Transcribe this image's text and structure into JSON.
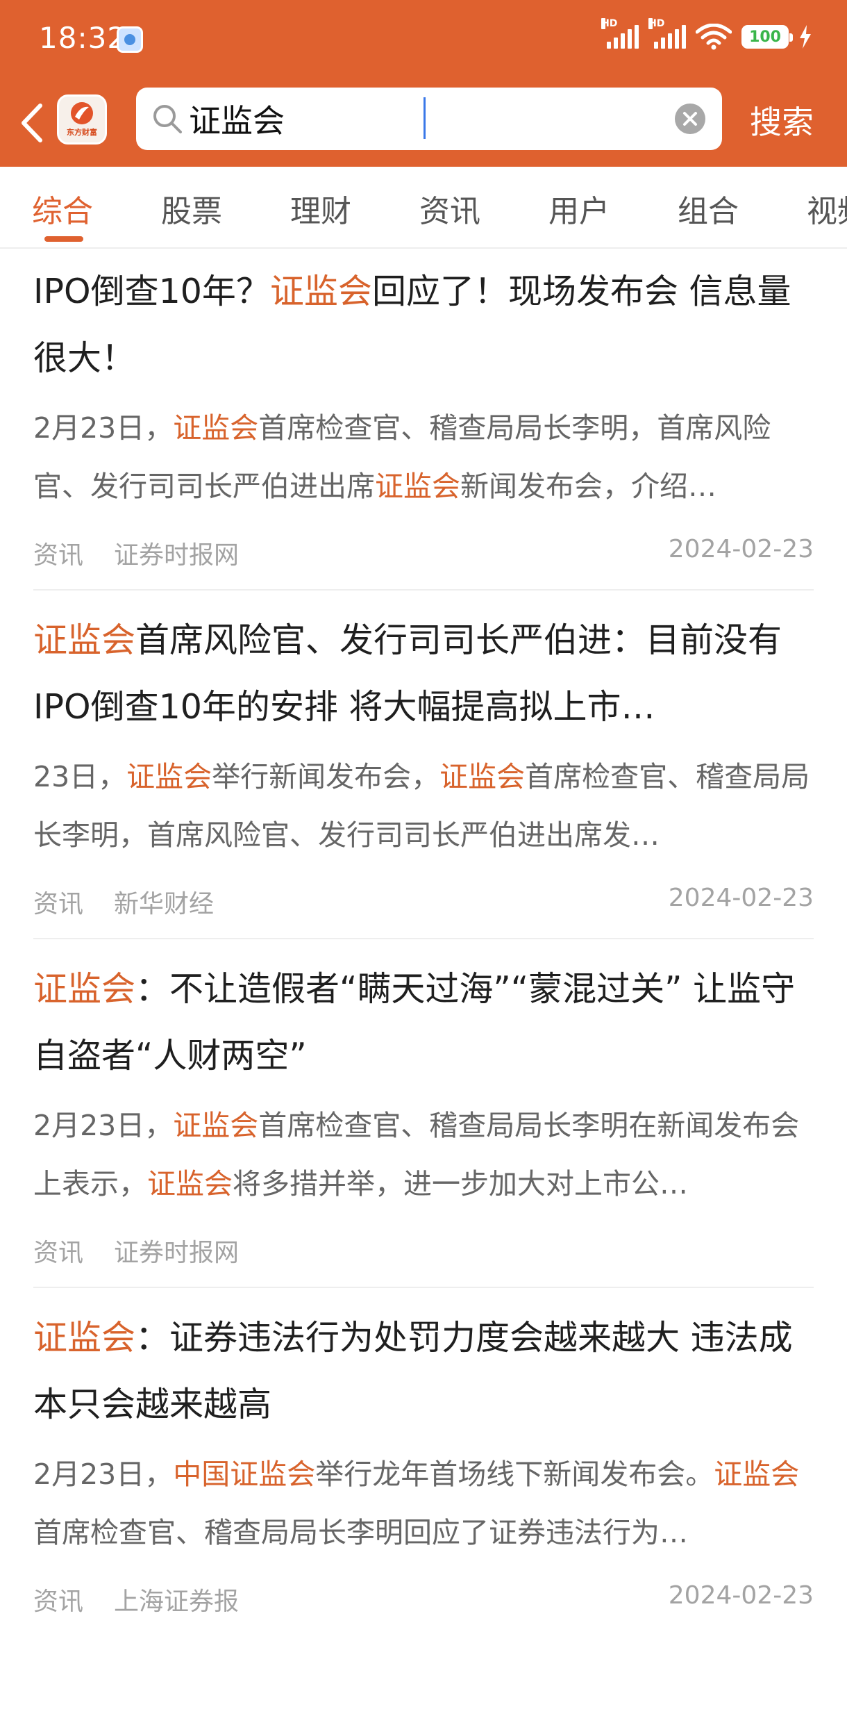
{
  "status_bar": {
    "time": "18:32",
    "battery": "100",
    "hd1": "HD",
    "hd2": "HD"
  },
  "search": {
    "query": "证监会",
    "button_label": "搜索"
  },
  "tabs": [
    "综合",
    "股票",
    "理财",
    "资讯",
    "用户",
    "组合",
    "视频"
  ],
  "accent_color": "#df612f",
  "results": [
    {
      "title_parts": [
        {
          "t": "IPO倒查10年？",
          "h": false
        },
        {
          "t": "证监会",
          "h": true
        },
        {
          "t": "回应了！现场发布会 信息量很大！",
          "h": false
        }
      ],
      "summary_parts": [
        {
          "t": "2月23日，",
          "h": false
        },
        {
          "t": "证监会",
          "h": true
        },
        {
          "t": "首席检查官、稽查局局长李明，首席风险官、发行司司长严伯进出席",
          "h": false
        },
        {
          "t": "证监会",
          "h": true
        },
        {
          "t": "新闻发布会，介绍…",
          "h": false
        }
      ],
      "type": "资讯",
      "source": "证券时报网",
      "date": "2024-02-23"
    },
    {
      "title_parts": [
        {
          "t": "证监会",
          "h": true
        },
        {
          "t": "首席风险官、发行司司长严伯进：目前没有IPO倒查10年的安排 将大幅提高拟上市…",
          "h": false
        }
      ],
      "summary_parts": [
        {
          "t": "23日，",
          "h": false
        },
        {
          "t": "证监会",
          "h": true
        },
        {
          "t": "举行新闻发布会，",
          "h": false
        },
        {
          "t": "证监会",
          "h": true
        },
        {
          "t": "首席检查官、稽查局局长李明，首席风险官、发行司司长严伯进出席发…",
          "h": false
        }
      ],
      "type": "资讯",
      "source": "新华财经",
      "date": "2024-02-23"
    },
    {
      "title_parts": [
        {
          "t": "证监会",
          "h": true
        },
        {
          "t": "：不让造假者“瞒天过海”“蒙混过关” 让监守自盗者“人财两空”",
          "h": false
        }
      ],
      "summary_parts": [
        {
          "t": "2月23日，",
          "h": false
        },
        {
          "t": "证监会",
          "h": true
        },
        {
          "t": "首席检查官、稽查局局长李明在新闻发布会上表示，",
          "h": false
        },
        {
          "t": "证监会",
          "h": true
        },
        {
          "t": "将多措并举，进一步加大对上市公…",
          "h": false
        }
      ],
      "type": "资讯",
      "source": "证券时报网",
      "date": ""
    },
    {
      "title_parts": [
        {
          "t": "证监会",
          "h": true
        },
        {
          "t": "：证券违法行为处罚力度会越来越大 违法成本只会越来越高",
          "h": false
        }
      ],
      "summary_parts": [
        {
          "t": "2月23日，",
          "h": false
        },
        {
          "t": "中国证监会",
          "h": true
        },
        {
          "t": "举行龙年首场线下新闻发布会。",
          "h": false
        },
        {
          "t": "证监会",
          "h": true
        },
        {
          "t": "首席检查官、稽查局局长李明回应了证券违法行为…",
          "h": false
        }
      ],
      "type": "资讯",
      "source": "上海证券报",
      "date": "2024-02-23"
    }
  ]
}
